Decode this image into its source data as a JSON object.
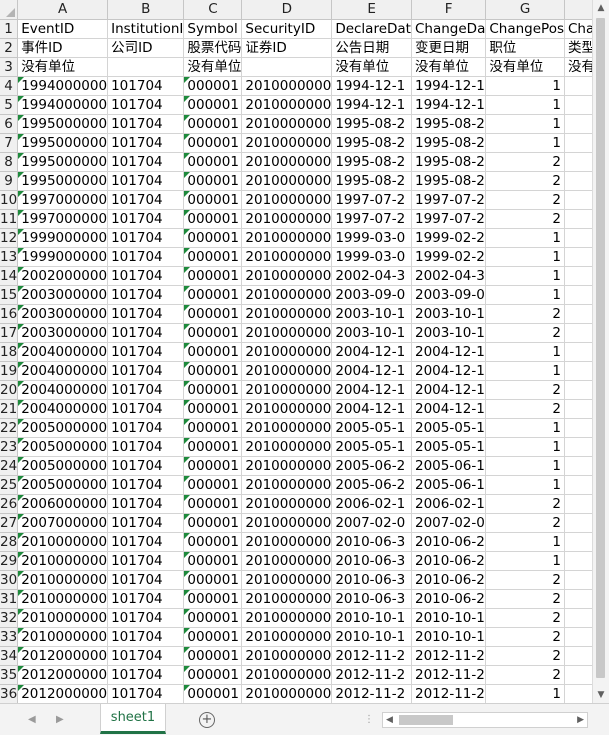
{
  "sheet": {
    "columns": [
      "A",
      "B",
      "C",
      "D",
      "E",
      "F",
      "G",
      "H"
    ],
    "row_numbers": [
      "1",
      "2",
      "3",
      "4",
      "5",
      "6",
      "7",
      "8",
      "9",
      "10",
      "11",
      "12",
      "13",
      "14",
      "15",
      "16",
      "17",
      "18",
      "19",
      "20",
      "21",
      "22",
      "23",
      "24",
      "25",
      "26",
      "27",
      "28",
      "29",
      "30",
      "31",
      "32",
      "33",
      "34",
      "35",
      "36"
    ],
    "rows": [
      [
        "EventID",
        "InstitutionI",
        "Symbol",
        "SecurityID",
        "DeclareDat",
        "ChangeDa",
        "ChangePos",
        "ChangeT"
      ],
      [
        "事件ID",
        "公司ID",
        "股票代码",
        "证券ID",
        "公告日期",
        "变更日期",
        "职位",
        "类型"
      ],
      [
        "没有单位",
        "",
        "没有单位",
        "",
        "没有单位",
        "没有单位",
        "没有单位",
        "没有单位"
      ],
      [
        "1994000000",
        "101704",
        "000001",
        "2010000000",
        "1994-12-1",
        "1994-12-1",
        "1",
        ""
      ],
      [
        "1994000000",
        "101704",
        "000001",
        "2010000000",
        "1994-12-1",
        "1994-12-1",
        "1",
        ""
      ],
      [
        "1995000000",
        "101704",
        "000001",
        "2010000000",
        "1995-08-2",
        "1995-08-2",
        "1",
        ""
      ],
      [
        "1995000000",
        "101704",
        "000001",
        "2010000000",
        "1995-08-2",
        "1995-08-2",
        "1",
        ""
      ],
      [
        "1995000000",
        "101704",
        "000001",
        "2010000000",
        "1995-08-2",
        "1995-08-2",
        "2",
        ""
      ],
      [
        "1995000000",
        "101704",
        "000001",
        "2010000000",
        "1995-08-2",
        "1995-08-2",
        "2",
        ""
      ],
      [
        "1997000000",
        "101704",
        "000001",
        "2010000000",
        "1997-07-2",
        "1997-07-2",
        "2",
        ""
      ],
      [
        "1997000000",
        "101704",
        "000001",
        "2010000000",
        "1997-07-2",
        "1997-07-2",
        "2",
        ""
      ],
      [
        "1999000000",
        "101704",
        "000001",
        "2010000000",
        "1999-03-0",
        "1999-02-2",
        "1",
        ""
      ],
      [
        "1999000000",
        "101704",
        "000001",
        "2010000000",
        "1999-03-0",
        "1999-02-2",
        "1",
        ""
      ],
      [
        "2002000000",
        "101704",
        "000001",
        "2010000000",
        "2002-04-3",
        "2002-04-3",
        "1",
        ""
      ],
      [
        "2003000000",
        "101704",
        "000001",
        "2010000000",
        "2003-09-0",
        "2003-09-0",
        "1",
        ""
      ],
      [
        "2003000000",
        "101704",
        "000001",
        "2010000000",
        "2003-10-1",
        "2003-10-1",
        "2",
        ""
      ],
      [
        "2003000000",
        "101704",
        "000001",
        "2010000000",
        "2003-10-1",
        "2003-10-1",
        "2",
        ""
      ],
      [
        "2004000000",
        "101704",
        "000001",
        "2010000000",
        "2004-12-1",
        "2004-12-1",
        "1",
        ""
      ],
      [
        "2004000000",
        "101704",
        "000001",
        "2010000000",
        "2004-12-1",
        "2004-12-1",
        "1",
        ""
      ],
      [
        "2004000000",
        "101704",
        "000001",
        "2010000000",
        "2004-12-1",
        "2004-12-1",
        "2",
        ""
      ],
      [
        "2004000000",
        "101704",
        "000001",
        "2010000000",
        "2004-12-1",
        "2004-12-1",
        "2",
        ""
      ],
      [
        "2005000000",
        "101704",
        "000001",
        "2010000000",
        "2005-05-1",
        "2005-05-1",
        "1",
        ""
      ],
      [
        "2005000000",
        "101704",
        "000001",
        "2010000000",
        "2005-05-1",
        "2005-05-1",
        "1",
        ""
      ],
      [
        "2005000000",
        "101704",
        "000001",
        "2010000000",
        "2005-06-2",
        "2005-06-1",
        "1",
        ""
      ],
      [
        "2005000000",
        "101704",
        "000001",
        "2010000000",
        "2005-06-2",
        "2005-06-1",
        "1",
        ""
      ],
      [
        "2006000000",
        "101704",
        "000001",
        "2010000000",
        "2006-02-1",
        "2006-02-1",
        "2",
        ""
      ],
      [
        "2007000000",
        "101704",
        "000001",
        "2010000000",
        "2007-02-0",
        "2007-02-0",
        "2",
        ""
      ],
      [
        "2010000000",
        "101704",
        "000001",
        "2010000000",
        "2010-06-3",
        "2010-06-2",
        "1",
        ""
      ],
      [
        "2010000000",
        "101704",
        "000001",
        "2010000000",
        "2010-06-3",
        "2010-06-2",
        "1",
        ""
      ],
      [
        "2010000000",
        "101704",
        "000001",
        "2010000000",
        "2010-06-3",
        "2010-06-2",
        "2",
        ""
      ],
      [
        "2010000000",
        "101704",
        "000001",
        "2010000000",
        "2010-06-3",
        "2010-06-2",
        "2",
        ""
      ],
      [
        "2010000000",
        "101704",
        "000001",
        "2010000000",
        "2010-10-1",
        "2010-10-1",
        "2",
        ""
      ],
      [
        "2010000000",
        "101704",
        "000001",
        "2010000000",
        "2010-10-1",
        "2010-10-1",
        "2",
        ""
      ],
      [
        "2012000000",
        "101704",
        "000001",
        "2010000000",
        "2012-11-2",
        "2012-11-2",
        "2",
        ""
      ],
      [
        "2012000000",
        "101704",
        "000001",
        "2010000000",
        "2012-11-2",
        "2012-11-2",
        "2",
        ""
      ],
      [
        "2012000000",
        "101704",
        "000001",
        "2010000000",
        "2012-11-2",
        "2012-11-2",
        "1",
        ""
      ]
    ]
  },
  "tabs": {
    "active": "sheet1",
    "add_label": "+"
  },
  "nav": {
    "prev": "◀",
    "next": "▶",
    "divider": "⋮"
  },
  "scroll": {
    "up": "▲",
    "down": "▼",
    "left": "◀",
    "right": "▶"
  },
  "colors": {
    "tab_accent": "#217346",
    "error_marker": "#1e8a3c"
  }
}
